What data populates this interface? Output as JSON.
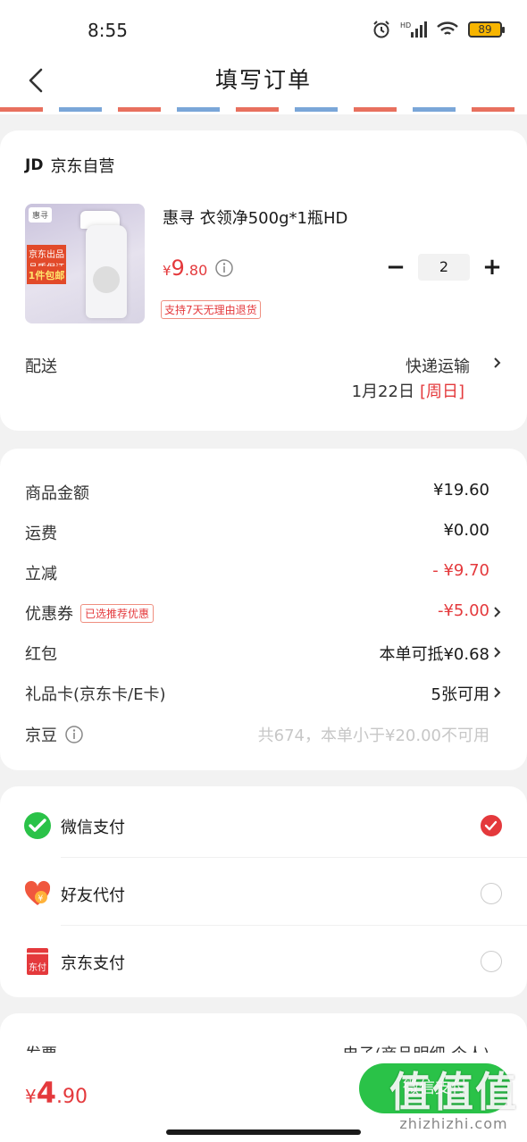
{
  "status_bar": {
    "time": "8:55",
    "battery": "89",
    "icons": [
      "alarm-icon",
      "hd-signal-icon",
      "wifi-icon",
      "battery-icon"
    ]
  },
  "navbar": {
    "title": "填写订单",
    "back_icon": "chevron-left-icon"
  },
  "shop": {
    "logo": "JD",
    "name": "京东自营"
  },
  "product": {
    "image_brand": "惠寻",
    "image_tag": "京东出品 品质保证",
    "image_badge": "1件包邮",
    "title": "惠寻 衣领净500g*1瓶HD",
    "price_symbol": "¥",
    "price_int": "9",
    "price_dec": ".80",
    "return_policy": "支持7天无理由退货",
    "quantity": "2",
    "minus": "−",
    "plus": "+"
  },
  "delivery": {
    "label": "配送",
    "method": "快递运输",
    "date": "1月22日",
    "weekday": "[周日]"
  },
  "summary": {
    "rows": [
      {
        "label": "商品金额",
        "value": "¥19.60"
      },
      {
        "label": "运费",
        "value": "¥0.00"
      },
      {
        "label": "立减",
        "value": "- ¥9.70"
      },
      {
        "label": "优惠券",
        "badge": "已选推荐优惠",
        "value": "-¥5.00"
      },
      {
        "label": "红包",
        "value": "本单可抵¥0.68"
      },
      {
        "label": "礼品卡(京东卡/E卡)",
        "value": "5张可用"
      },
      {
        "label": "京豆",
        "value": "共674，本单小于¥20.00不可用"
      }
    ]
  },
  "payment": {
    "methods": [
      {
        "label": "微信支付",
        "selected": true
      },
      {
        "label": "好友代付",
        "selected": false
      },
      {
        "label": "京东支付",
        "icon_text": "东付",
        "selected": false
      }
    ]
  },
  "invoice": {
    "label": "发票",
    "value": "电子(商品明细-个人)"
  },
  "bottom": {
    "total_symbol": "¥",
    "total_int": "4",
    "total_dec": ".90",
    "submit": "微信支付"
  },
  "watermark": {
    "main": "值值值",
    "sub": "zhizhizhi.com"
  },
  "colors": {
    "accent_red": "#e4393c",
    "wechat_green": "#2ac248"
  }
}
